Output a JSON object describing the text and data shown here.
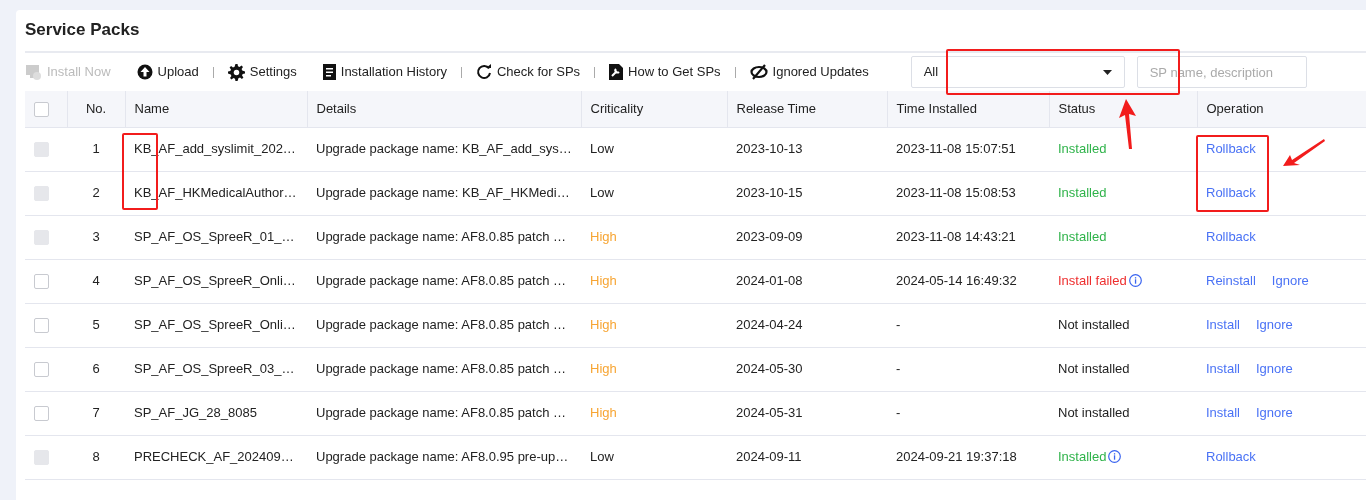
{
  "title": "Service Packs",
  "toolbar": [
    {
      "label": "Install Now",
      "disabled": true,
      "separator_after": false
    },
    {
      "label": "Upload",
      "disabled": false,
      "separator_after": true
    },
    {
      "label": "Settings",
      "disabled": false,
      "separator_after": false
    },
    {
      "label": "Installation History",
      "disabled": false,
      "separator_after": true
    },
    {
      "label": "Check for SPs",
      "disabled": false,
      "separator_after": true
    },
    {
      "label": "How to Get SPs",
      "disabled": false,
      "separator_after": true
    },
    {
      "label": "Ignored Updates",
      "disabled": false,
      "separator_after": false
    }
  ],
  "filter": {
    "value": "All"
  },
  "search": {
    "placeholder": "SP name, description"
  },
  "table": {
    "select_all": {
      "checked": false
    },
    "columns": [
      "No.",
      "Name",
      "Details",
      "Criticality",
      "Release Time",
      "Time Installed",
      "Status",
      "Operation"
    ],
    "rows": [
      {
        "disabled": true,
        "no": "1",
        "name": "KB_AF_add_syslimit_202…",
        "details": "Upgrade package name: KB_AF_add_sys…",
        "criticality": {
          "text": "Low",
          "color": "#222222"
        },
        "release": "2023-10-13",
        "installed": "2023-11-08 15:07:51",
        "status": {
          "text": "Installed",
          "color": "#2fb34a"
        },
        "info": false,
        "operations": [
          "Rollback"
        ]
      },
      {
        "disabled": true,
        "no": "2",
        "name": "KB_AF_HKMedicalAuthor…",
        "details": "Upgrade package name: KB_AF_HKMedi…",
        "criticality": {
          "text": "Low",
          "color": "#222222"
        },
        "release": "2023-10-15",
        "installed": "2023-11-08 15:08:53",
        "status": {
          "text": "Installed",
          "color": "#2fb34a"
        },
        "info": false,
        "operations": [
          "Rollback"
        ]
      },
      {
        "disabled": true,
        "no": "3",
        "name": "SP_AF_OS_SpreeR_01_…",
        "details": "Upgrade package name: AF8.0.85 patch …",
        "criticality": {
          "text": "High",
          "color": "#f7a533"
        },
        "release": "2023-09-09",
        "installed": "2023-11-08 14:43:21",
        "status": {
          "text": "Installed",
          "color": "#2fb34a"
        },
        "info": false,
        "operations": [
          "Rollback"
        ]
      },
      {
        "disabled": false,
        "no": "4",
        "name": "SP_AF_OS_SpreeR_Onli…",
        "details": "Upgrade package name: AF8.0.85 patch …",
        "criticality": {
          "text": "High",
          "color": "#f7a533"
        },
        "release": "2024-01-08",
        "installed": "2024-05-14 16:49:32",
        "status": {
          "text": "Install failed",
          "color": "#ee2e2e"
        },
        "info": true,
        "operations": [
          "Reinstall",
          "Ignore"
        ]
      },
      {
        "disabled": false,
        "no": "5",
        "name": "SP_AF_OS_SpreeR_Onli…",
        "details": "Upgrade package name: AF8.0.85 patch …",
        "criticality": {
          "text": "High",
          "color": "#f7a533"
        },
        "release": "2024-04-24",
        "installed": "-",
        "status": {
          "text": "Not installed",
          "color": "#222222"
        },
        "info": false,
        "operations": [
          "Install",
          "Ignore"
        ]
      },
      {
        "disabled": false,
        "no": "6",
        "name": "SP_AF_OS_SpreeR_03_…",
        "details": "Upgrade package name: AF8.0.85 patch …",
        "criticality": {
          "text": "High",
          "color": "#f7a533"
        },
        "release": "2024-05-30",
        "installed": "-",
        "status": {
          "text": "Not installed",
          "color": "#222222"
        },
        "info": false,
        "operations": [
          "Install",
          "Ignore"
        ]
      },
      {
        "disabled": false,
        "no": "7",
        "name": "SP_AF_JG_28_8085",
        "details": "Upgrade package name: AF8.0.85 patch …",
        "criticality": {
          "text": "High",
          "color": "#f7a533"
        },
        "release": "2024-05-31",
        "installed": "-",
        "status": {
          "text": "Not installed",
          "color": "#222222"
        },
        "info": false,
        "operations": [
          "Install",
          "Ignore"
        ]
      },
      {
        "disabled": true,
        "no": "8",
        "name": "PRECHECK_AF_202409…",
        "details": "Upgrade package name: AF8.0.95 pre-up…",
        "criticality": {
          "text": "Low",
          "color": "#222222"
        },
        "release": "2024-09-11",
        "installed": "2024-09-21 19:37:18",
        "status": {
          "text": "Installed",
          "color": "#2fb34a"
        },
        "info": true,
        "operations": [
          "Rollback"
        ]
      }
    ]
  }
}
